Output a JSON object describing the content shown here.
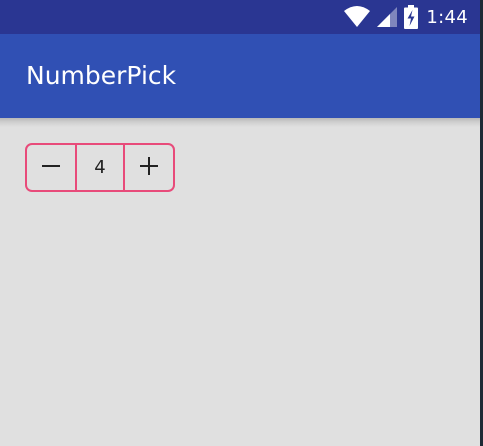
{
  "status_bar": {
    "time": "1:44",
    "icons": [
      "wifi-icon",
      "cellular-signal-icon",
      "battery-charging-icon"
    ]
  },
  "app_bar": {
    "title": "NumberPick"
  },
  "number_picker": {
    "value": "4",
    "decrement_icon": "minus-icon",
    "increment_icon": "plus-icon",
    "border_color": "#e84b7a"
  },
  "colors": {
    "status_bar": "#2a3692",
    "app_bar": "#3050b4",
    "background": "#e0e0e0",
    "accent": "#e84b7a"
  }
}
